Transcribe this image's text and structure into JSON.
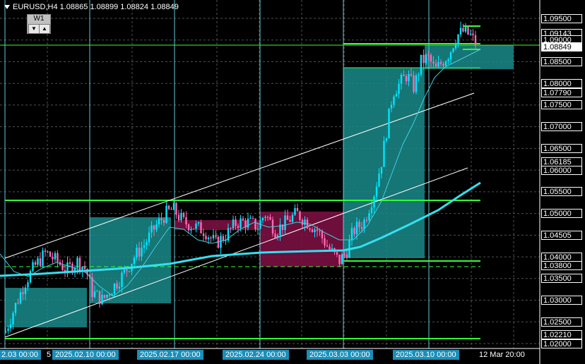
{
  "header": {
    "symbol_info": "EURUSD,H4  1.08865 1.08899 1.08824 1.08849",
    "timeframe_box": "W1",
    "down_arrow": "▼",
    "up_arrow": "▲"
  },
  "price_axis": {
    "labels": [
      "1.09500",
      "1.09143",
      "1.09000",
      "1.08849",
      "1.08500",
      "1.08000",
      "1.07790",
      "1.07500",
      "1.07000",
      "1.06500",
      "1.06185",
      "1.06000",
      "1.05500",
      "1.05000",
      "1.04505",
      "1.04000",
      "1.03800",
      "1.03500",
      "1.03000",
      "1.02500",
      "1.02210",
      "1.02000"
    ],
    "current": "1.08849"
  },
  "time_axis": {
    "labels": [
      "2.03 00:00",
      "5",
      "2025.02.10 00:00",
      "2025.02.17 00:00",
      "2025.02.24 00:00",
      "2025.03.03 00:00",
      "2025.03.10 00:00",
      "12 Mar 20:00"
    ]
  },
  "colors": {
    "background": "#000000",
    "bull": "#00e5ff",
    "bear": "#ff69b4",
    "ma_fast": "#3fd0e0",
    "ma_slow": "#33e0f0",
    "level": "#33ff33",
    "zone_teal": "#1a8a8a",
    "zone_maroon": "#7a1040",
    "grid": "#505050",
    "vline": "#5fc8d8",
    "channel": "#ffffff"
  },
  "icons": [
    "dropdown-triangle-icon"
  ]
}
